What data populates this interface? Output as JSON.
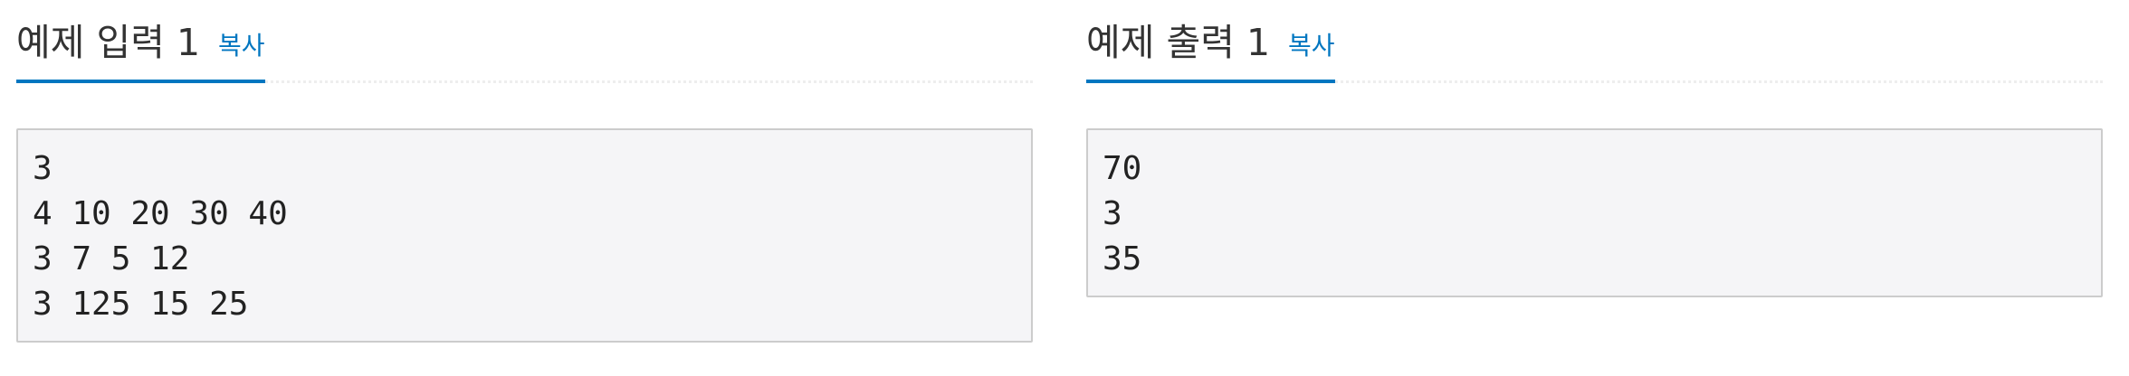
{
  "sample_input": {
    "title": "예제 입력 1",
    "copy_label": "복사",
    "lines": [
      "3",
      "4 10 20 30 40",
      "3 7 5 12",
      "3 125 15 25"
    ]
  },
  "sample_output": {
    "title": "예제 출력 1",
    "copy_label": "복사",
    "lines": [
      "70",
      "3",
      "35"
    ]
  },
  "colors": {
    "accent": "#0076c0",
    "title_text": "#333333",
    "code_background": "#f5f5f7",
    "code_border": "#cccccc"
  }
}
